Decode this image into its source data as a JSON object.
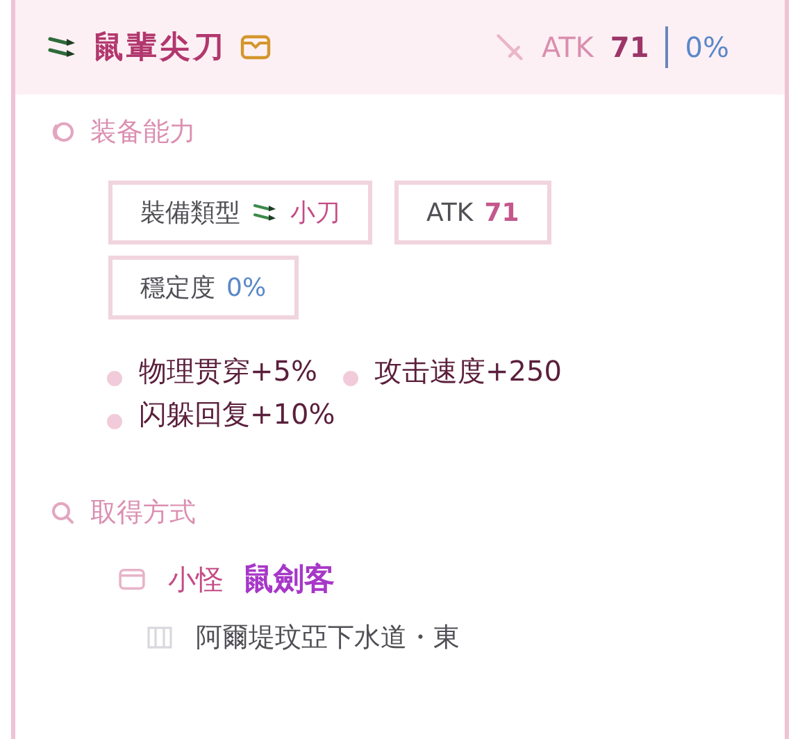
{
  "item": {
    "name": "鼠輩尖刀",
    "atk_label": "ATK",
    "atk_value": "71",
    "stability": "0%"
  },
  "ability": {
    "title": "装备能力",
    "tags": [
      {
        "kind": "type",
        "label": "裝備類型",
        "value": "小刀"
      },
      {
        "kind": "atk",
        "label": "ATK",
        "value": "71"
      },
      {
        "kind": "stability",
        "label": "穩定度",
        "value": "0%"
      }
    ],
    "effects": [
      "物理贯穿+5%",
      "攻击速度+250",
      "闪躲回复+10%"
    ]
  },
  "acquire": {
    "title": "取得方式",
    "source_type": "小怪",
    "source_name": "鼠劍客",
    "location": "阿爾堤玟亞下水道・東"
  }
}
